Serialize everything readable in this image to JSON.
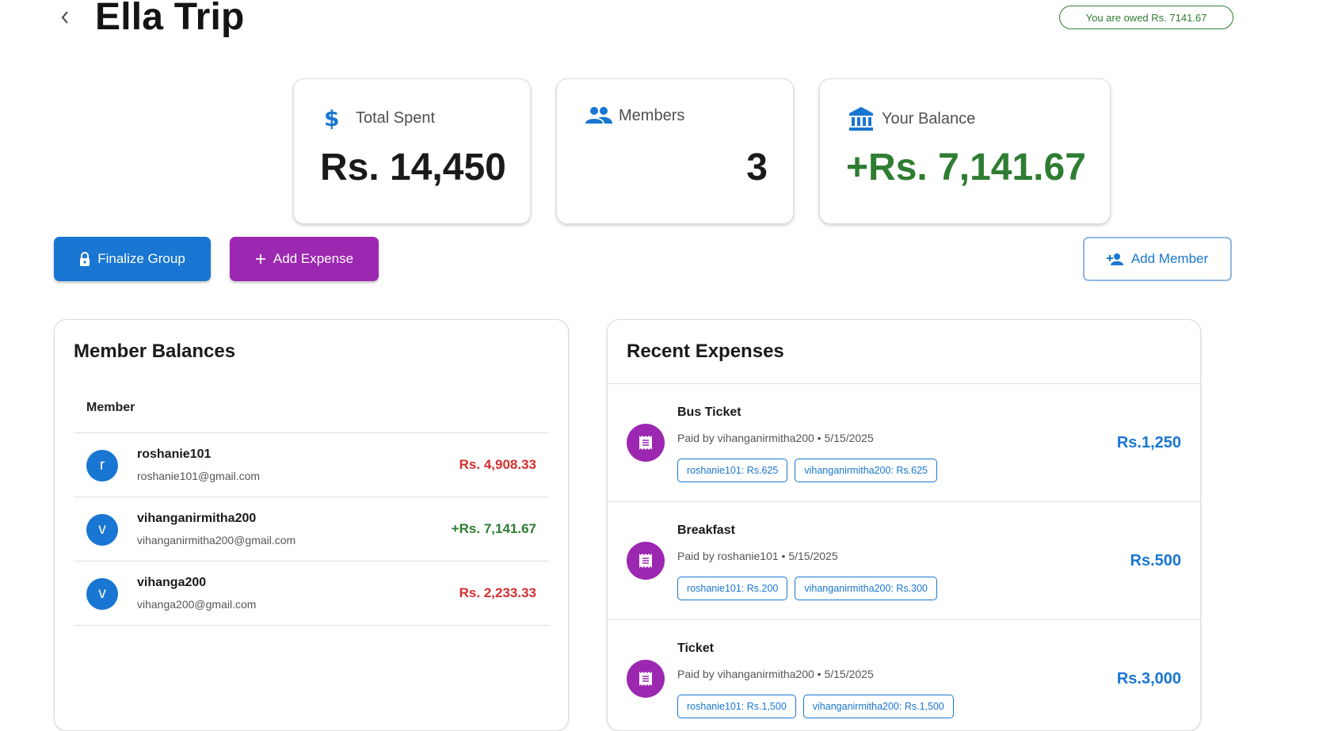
{
  "header": {
    "title": "Ella Trip",
    "owed_text": "You are owed Rs. 7141.67"
  },
  "stats": {
    "total_spent": {
      "label": "Total Spent",
      "value": "Rs. 14,450"
    },
    "members": {
      "label": "Members",
      "value": "3"
    },
    "balance": {
      "label": "Your Balance",
      "value": "+Rs. 7,141.67"
    }
  },
  "actions": {
    "finalize": "Finalize Group",
    "add_expense": "Add Expense",
    "add_member": "Add Member"
  },
  "balances": {
    "title": "Member Balances",
    "column_header": "Member",
    "rows": [
      {
        "initial": "r",
        "name": "roshanie101",
        "email": "roshanie101@gmail.com",
        "amount": "Rs. 4,908.33",
        "status": "negative"
      },
      {
        "initial": "v",
        "name": "vihanganirmitha200",
        "email": "vihanganirmitha200@gmail.com",
        "amount": "+Rs. 7,141.67",
        "status": "positive"
      },
      {
        "initial": "v",
        "name": "vihanga200",
        "email": "vihanga200@gmail.com",
        "amount": "Rs. 2,233.33",
        "status": "negative"
      }
    ]
  },
  "expenses": {
    "title": "Recent Expenses",
    "items": [
      {
        "name": "Bus Ticket",
        "meta": "Paid by vihanganirmitha200 • 5/15/2025",
        "amount": "Rs.1,250",
        "splits": [
          "roshanie101: Rs.625",
          "vihanganirmitha200: Rs.625"
        ]
      },
      {
        "name": "Breakfast",
        "meta": "Paid by roshanie101 • 5/15/2025",
        "amount": "Rs.500",
        "splits": [
          "roshanie101: Rs.200",
          "vihanganirmitha200: Rs.300"
        ]
      },
      {
        "name": "Ticket",
        "meta": "Paid by vihanganirmitha200 • 5/15/2025",
        "amount": "Rs.3,000",
        "splits": [
          "roshanie101: Rs.1,500",
          "vihanganirmitha200: Rs.1,500"
        ]
      }
    ]
  },
  "colors": {
    "primary": "#1976d2",
    "secondary": "#9c27b0",
    "positive": "#2e7d32",
    "negative": "#d32f2f"
  }
}
